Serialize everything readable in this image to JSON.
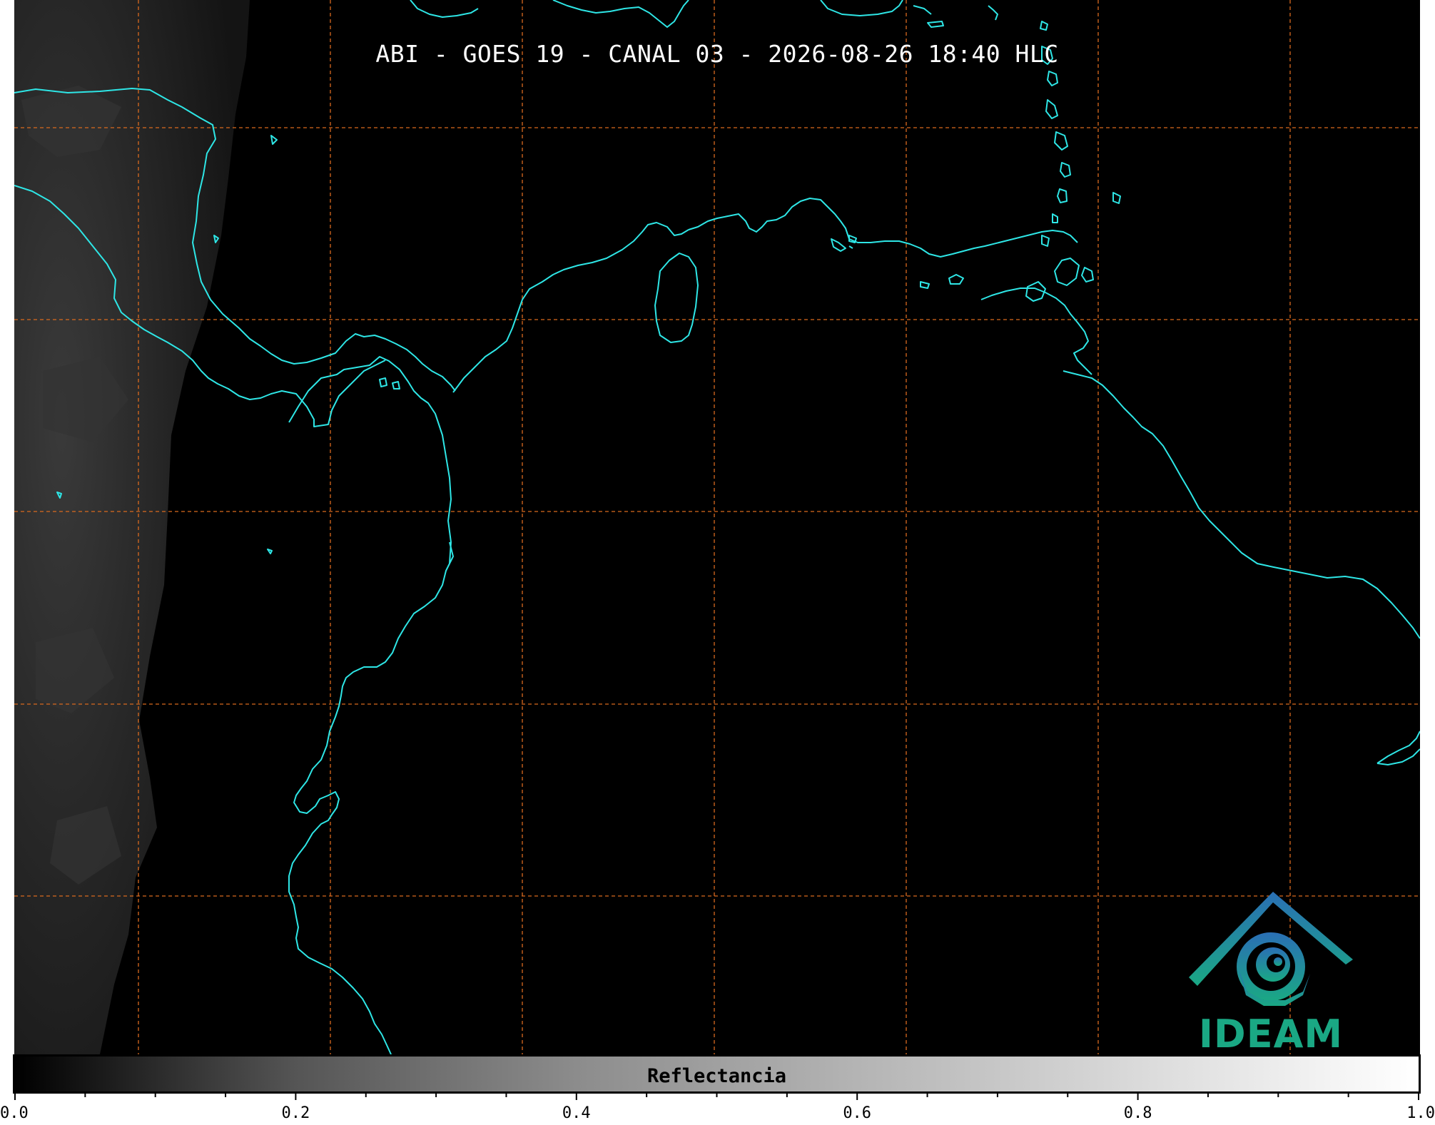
{
  "title": "ABI - GOES 19 - CANAL 03 - 2026-08-26 18:40 HLC",
  "colors": {
    "ocean": "#000000",
    "coastline": "#2ee6e6",
    "gridlines": "#d96a1e",
    "land_tint": "#262626",
    "logo_blue": "#2a6fb5",
    "logo_green": "#1aa884"
  },
  "logo": {
    "text": "IDEAM",
    "icon": "ideam-mountain-spiral-icon"
  },
  "colorbar": {
    "label": "Reflectancia",
    "min": 0.0,
    "max": 1.0,
    "colormap": "gray",
    "major_ticks": [
      "0.0",
      "0.2",
      "0.4",
      "0.6",
      "0.8",
      "1.0"
    ],
    "minor_tick_count": 21
  },
  "map": {
    "gridlines": "dashed",
    "grid_columns": 7,
    "grid_rows": 5
  }
}
